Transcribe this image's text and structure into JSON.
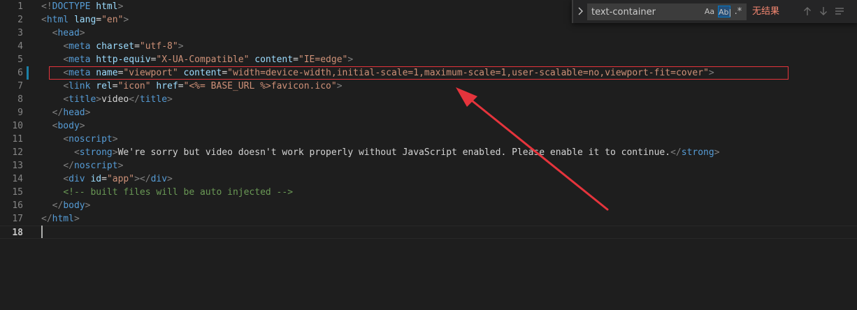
{
  "editor": {
    "language": "html",
    "active_line": 18,
    "modified_line": 6,
    "lines": [
      {
        "n": "1",
        "tokens": [
          {
            "c": "t-punc",
            "t": "<!"
          },
          {
            "c": "t-tag",
            "t": "DOCTYPE"
          },
          {
            "c": "t-text",
            "t": " "
          },
          {
            "c": "t-attr",
            "t": "html"
          },
          {
            "c": "t-punc",
            "t": ">"
          }
        ]
      },
      {
        "n": "2",
        "tokens": [
          {
            "c": "t-punc",
            "t": "<"
          },
          {
            "c": "t-tag",
            "t": "html"
          },
          {
            "c": "t-text",
            "t": " "
          },
          {
            "c": "t-attr",
            "t": "lang"
          },
          {
            "c": "t-text",
            "t": "="
          },
          {
            "c": "t-str",
            "t": "\"en\""
          },
          {
            "c": "t-punc",
            "t": ">"
          }
        ]
      },
      {
        "n": "3",
        "tokens": [
          {
            "c": "t-text",
            "t": "  "
          },
          {
            "c": "t-punc",
            "t": "<"
          },
          {
            "c": "t-tag",
            "t": "head"
          },
          {
            "c": "t-punc",
            "t": ">"
          }
        ]
      },
      {
        "n": "4",
        "tokens": [
          {
            "c": "t-text",
            "t": "    "
          },
          {
            "c": "t-punc",
            "t": "<"
          },
          {
            "c": "t-tag",
            "t": "meta"
          },
          {
            "c": "t-text",
            "t": " "
          },
          {
            "c": "t-attr",
            "t": "charset"
          },
          {
            "c": "t-text",
            "t": "="
          },
          {
            "c": "t-str",
            "t": "\"utf-8\""
          },
          {
            "c": "t-punc",
            "t": ">"
          }
        ]
      },
      {
        "n": "5",
        "tokens": [
          {
            "c": "t-text",
            "t": "    "
          },
          {
            "c": "t-punc",
            "t": "<"
          },
          {
            "c": "t-tag",
            "t": "meta"
          },
          {
            "c": "t-text",
            "t": " "
          },
          {
            "c": "t-attr",
            "t": "http-equiv"
          },
          {
            "c": "t-text",
            "t": "="
          },
          {
            "c": "t-str",
            "t": "\"X-UA-Compatible\""
          },
          {
            "c": "t-text",
            "t": " "
          },
          {
            "c": "t-attr",
            "t": "content"
          },
          {
            "c": "t-text",
            "t": "="
          },
          {
            "c": "t-str",
            "t": "\"IE=edge\""
          },
          {
            "c": "t-punc",
            "t": ">"
          }
        ]
      },
      {
        "n": "6",
        "tokens": [
          {
            "c": "t-text",
            "t": "    "
          },
          {
            "c": "t-punc",
            "t": "<"
          },
          {
            "c": "t-tag",
            "t": "meta"
          },
          {
            "c": "t-text",
            "t": " "
          },
          {
            "c": "t-attr",
            "t": "name"
          },
          {
            "c": "t-text",
            "t": "="
          },
          {
            "c": "t-str",
            "t": "\"viewport\""
          },
          {
            "c": "t-text",
            "t": " "
          },
          {
            "c": "t-attr",
            "t": "content"
          },
          {
            "c": "t-text",
            "t": "="
          },
          {
            "c": "t-str",
            "t": "\"width=device-width,initial-scale=1,maximum-scale=1,user-scalable=no,viewport-fit=cover\""
          },
          {
            "c": "t-punc",
            "t": ">"
          }
        ]
      },
      {
        "n": "7",
        "tokens": [
          {
            "c": "t-text",
            "t": "    "
          },
          {
            "c": "t-punc",
            "t": "<"
          },
          {
            "c": "t-tag",
            "t": "link"
          },
          {
            "c": "t-text",
            "t": " "
          },
          {
            "c": "t-attr",
            "t": "rel"
          },
          {
            "c": "t-text",
            "t": "="
          },
          {
            "c": "t-str",
            "t": "\"icon\""
          },
          {
            "c": "t-text",
            "t": " "
          },
          {
            "c": "t-attr",
            "t": "href"
          },
          {
            "c": "t-text",
            "t": "="
          },
          {
            "c": "t-str",
            "t": "\"<%= BASE_URL %>favicon.ico\""
          },
          {
            "c": "t-punc",
            "t": ">"
          }
        ]
      },
      {
        "n": "8",
        "tokens": [
          {
            "c": "t-text",
            "t": "    "
          },
          {
            "c": "t-punc",
            "t": "<"
          },
          {
            "c": "t-tag",
            "t": "title"
          },
          {
            "c": "t-punc",
            "t": ">"
          },
          {
            "c": "t-text",
            "t": "video"
          },
          {
            "c": "t-punc",
            "t": "</"
          },
          {
            "c": "t-tag",
            "t": "title"
          },
          {
            "c": "t-punc",
            "t": ">"
          }
        ]
      },
      {
        "n": "9",
        "tokens": [
          {
            "c": "t-text",
            "t": "  "
          },
          {
            "c": "t-punc",
            "t": "</"
          },
          {
            "c": "t-tag",
            "t": "head"
          },
          {
            "c": "t-punc",
            "t": ">"
          }
        ]
      },
      {
        "n": "10",
        "tokens": [
          {
            "c": "t-text",
            "t": "  "
          },
          {
            "c": "t-punc",
            "t": "<"
          },
          {
            "c": "t-tag",
            "t": "body"
          },
          {
            "c": "t-punc",
            "t": ">"
          }
        ]
      },
      {
        "n": "11",
        "tokens": [
          {
            "c": "t-text",
            "t": "    "
          },
          {
            "c": "t-punc",
            "t": "<"
          },
          {
            "c": "t-tag",
            "t": "noscript"
          },
          {
            "c": "t-punc",
            "t": ">"
          }
        ]
      },
      {
        "n": "12",
        "tokens": [
          {
            "c": "t-text",
            "t": "      "
          },
          {
            "c": "t-punc",
            "t": "<"
          },
          {
            "c": "t-tag",
            "t": "strong"
          },
          {
            "c": "t-punc",
            "t": ">"
          },
          {
            "c": "t-text",
            "t": "We're sorry but video doesn't work properly without JavaScript enabled. Please enable it to continue."
          },
          {
            "c": "t-punc",
            "t": "</"
          },
          {
            "c": "t-tag",
            "t": "strong"
          },
          {
            "c": "t-punc",
            "t": ">"
          }
        ]
      },
      {
        "n": "13",
        "tokens": [
          {
            "c": "t-text",
            "t": "    "
          },
          {
            "c": "t-punc",
            "t": "</"
          },
          {
            "c": "t-tag",
            "t": "noscript"
          },
          {
            "c": "t-punc",
            "t": ">"
          }
        ]
      },
      {
        "n": "14",
        "tokens": [
          {
            "c": "t-text",
            "t": "    "
          },
          {
            "c": "t-punc",
            "t": "<"
          },
          {
            "c": "t-tag",
            "t": "div"
          },
          {
            "c": "t-text",
            "t": " "
          },
          {
            "c": "t-attr",
            "t": "id"
          },
          {
            "c": "t-text",
            "t": "="
          },
          {
            "c": "t-str",
            "t": "\"app\""
          },
          {
            "c": "t-punc",
            "t": "></"
          },
          {
            "c": "t-tag",
            "t": "div"
          },
          {
            "c": "t-punc",
            "t": ">"
          }
        ]
      },
      {
        "n": "15",
        "tokens": [
          {
            "c": "t-text",
            "t": "    "
          },
          {
            "c": "t-comment",
            "t": "<!-- built files will be auto injected -->"
          }
        ]
      },
      {
        "n": "16",
        "tokens": [
          {
            "c": "t-text",
            "t": "  "
          },
          {
            "c": "t-punc",
            "t": "</"
          },
          {
            "c": "t-tag",
            "t": "body"
          },
          {
            "c": "t-punc",
            "t": ">"
          }
        ]
      },
      {
        "n": "17",
        "tokens": [
          {
            "c": "t-punc",
            "t": "</"
          },
          {
            "c": "t-tag",
            "t": "html"
          },
          {
            "c": "t-punc",
            "t": ">"
          }
        ]
      },
      {
        "n": "18",
        "tokens": []
      }
    ]
  },
  "find_widget": {
    "toggle_icon": "chevron-right-icon",
    "search_value": "text-container",
    "match_case_label": "Aa",
    "whole_word_label": "Ab|",
    "regex_label": ".*",
    "result_text": "无结果",
    "prev_icon": "arrow-up-icon",
    "next_icon": "arrow-down-icon",
    "selection_icon": "find-in-selection-icon"
  },
  "annotation": {
    "box_color": "#e5343c",
    "arrow_color": "#e5343c"
  }
}
